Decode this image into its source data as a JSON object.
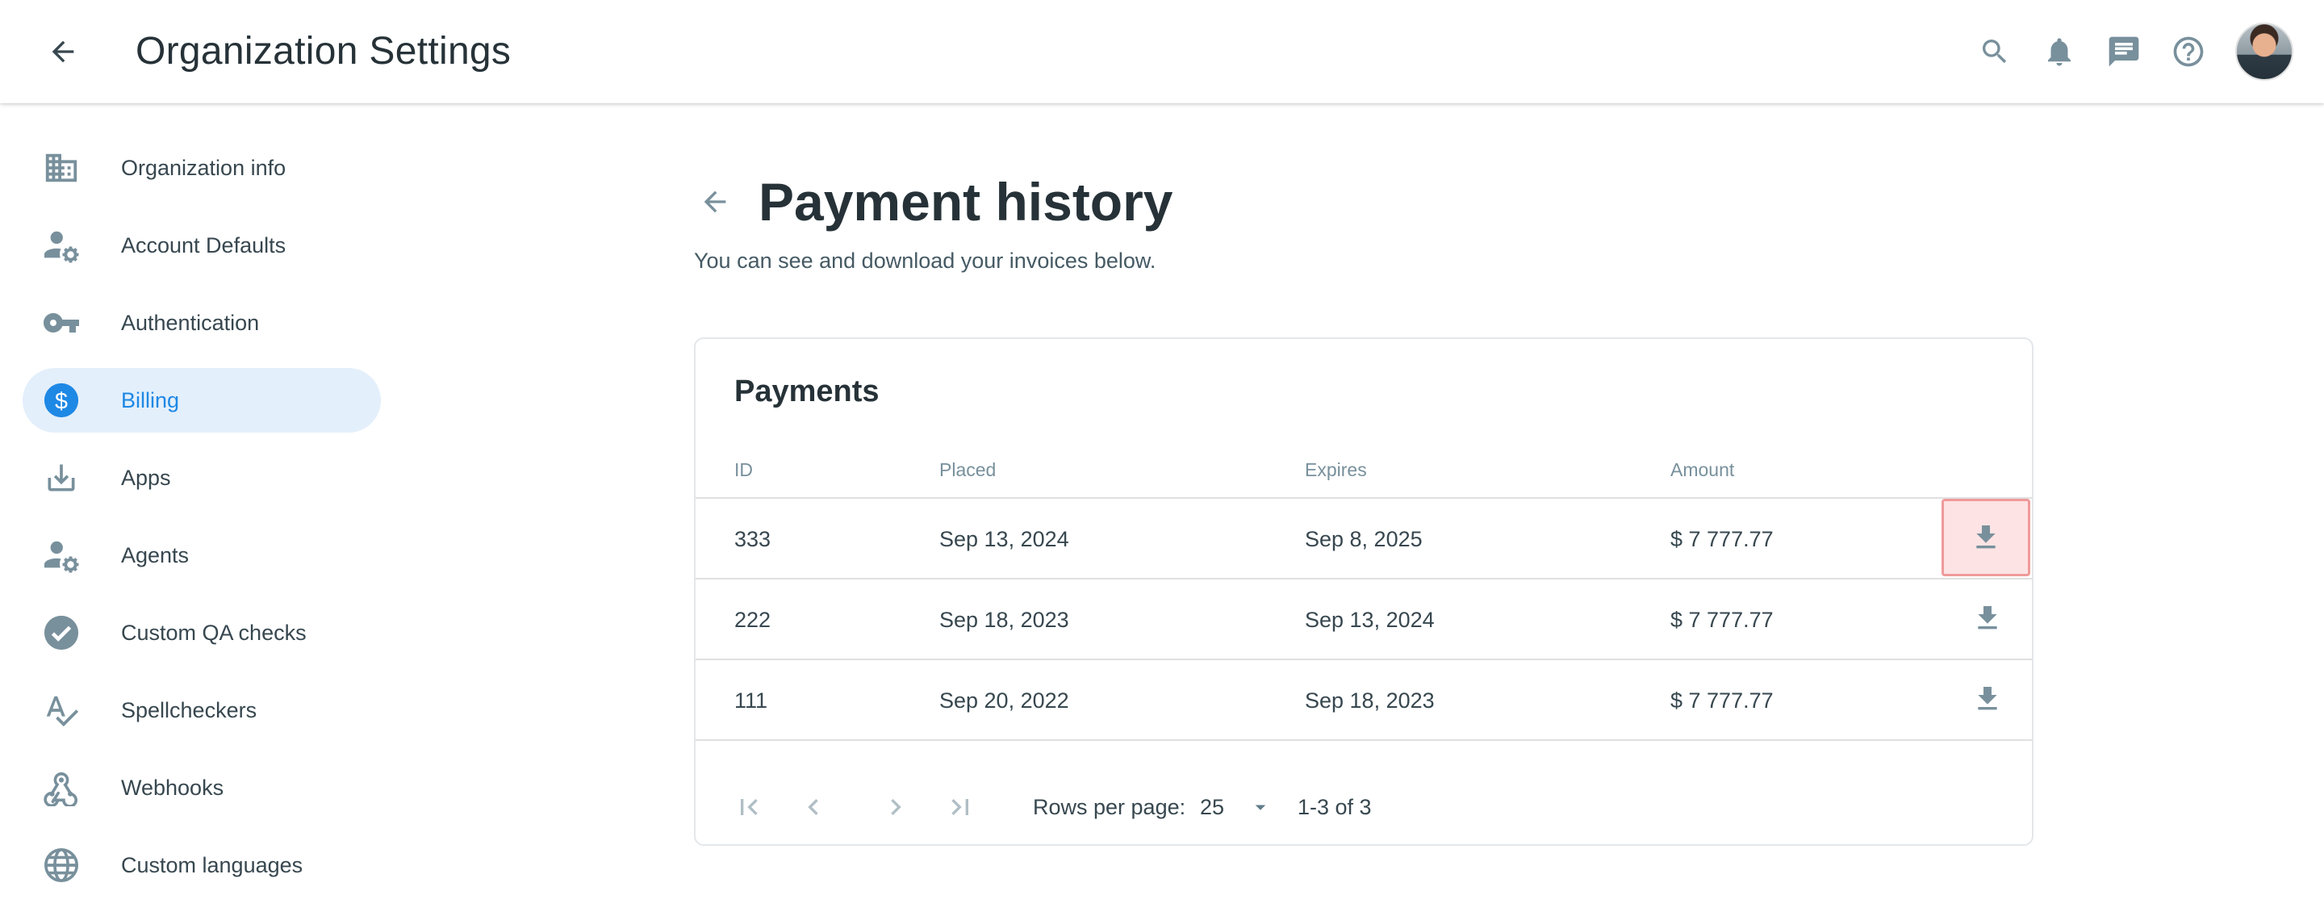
{
  "appbar": {
    "title": "Organization Settings"
  },
  "sidebar": {
    "items": [
      {
        "label": "Organization info",
        "icon": "building-icon",
        "active": false
      },
      {
        "label": "Account Defaults",
        "icon": "user-settings-icon",
        "active": false
      },
      {
        "label": "Authentication",
        "icon": "key-icon",
        "active": false
      },
      {
        "label": "Billing",
        "icon": "dollar-icon",
        "active": true
      },
      {
        "label": "Apps",
        "icon": "download-icon",
        "active": false
      },
      {
        "label": "Agents",
        "icon": "user-settings-icon",
        "active": false
      },
      {
        "label": "Custom QA checks",
        "icon": "check-circle-icon",
        "active": false
      },
      {
        "label": "Spellcheckers",
        "icon": "spellcheck-icon",
        "active": false
      },
      {
        "label": "Webhooks",
        "icon": "webhook-icon",
        "active": false
      },
      {
        "label": "Custom languages",
        "icon": "globe-icon",
        "active": false
      }
    ]
  },
  "page": {
    "title": "Payment history",
    "subtitle": "You can see and download your invoices below."
  },
  "payments": {
    "title": "Payments",
    "columns": [
      "ID",
      "Placed",
      "Expires",
      "Amount"
    ],
    "rows": [
      {
        "id": "333",
        "placed": "Sep 13, 2024",
        "expires": "Sep 8, 2025",
        "amount": "$ 7 777.77"
      },
      {
        "id": "222",
        "placed": "Sep 18, 2023",
        "expires": "Sep 13, 2024",
        "amount": "$ 7 777.77"
      },
      {
        "id": "111",
        "placed": "Sep 20, 2022",
        "expires": "Sep 18, 2023",
        "amount": "$ 7 777.77"
      }
    ],
    "pagination": {
      "rows_per_page_label": "Rows per page:",
      "rows_per_page": "25",
      "range": "1-3 of 3"
    }
  },
  "colors": {
    "accent": "#1e88e5",
    "active_bg": "#e3effb",
    "icon_gray": "#78909c",
    "highlight_bg": "#fde3e4",
    "highlight_border": "#ef9a9a"
  }
}
